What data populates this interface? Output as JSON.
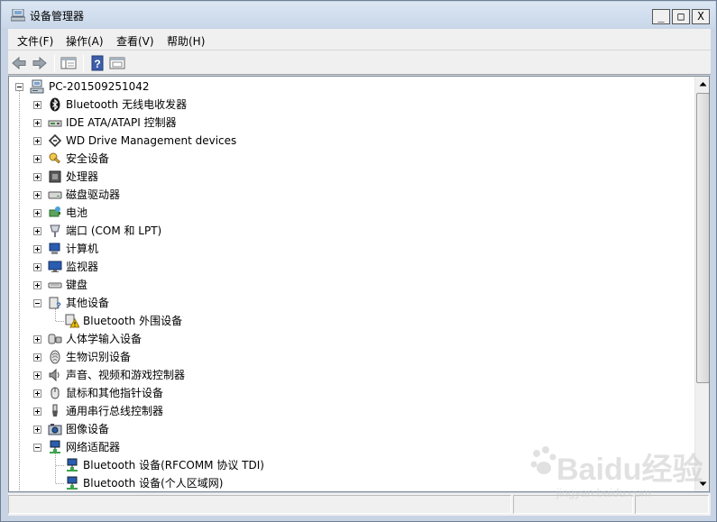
{
  "window": {
    "title": "设备管理器",
    "minimize": "_",
    "maximize": "□",
    "close": "X"
  },
  "menubar": [
    "文件(F)",
    "操作(A)",
    "查看(V)",
    "帮助(H)"
  ],
  "toolbar": {
    "buttons": [
      {
        "name": "back-button",
        "icon": "arrow-left-icon"
      },
      {
        "name": "forward-button",
        "icon": "arrow-right-icon"
      },
      {
        "name": "show-hide-console-tree-button",
        "icon": "console-tree-icon"
      },
      {
        "name": "help-button",
        "icon": "help-book-icon"
      },
      {
        "name": "properties-button",
        "icon": "properties-icon"
      }
    ]
  },
  "tree": {
    "root": "PC-201509251042",
    "items": [
      {
        "label": "Bluetooth 无线电收发器",
        "icon": "bluetooth-icon",
        "level": 1,
        "expander": "plus"
      },
      {
        "label": "IDE ATA/ATAPI 控制器",
        "icon": "ide-controller-icon",
        "level": 1,
        "expander": "plus"
      },
      {
        "label": "WD Drive Management devices",
        "icon": "wd-device-icon",
        "level": 1,
        "expander": "plus"
      },
      {
        "label": "安全设备",
        "icon": "security-device-icon",
        "level": 1,
        "expander": "plus"
      },
      {
        "label": "处理器",
        "icon": "processor-icon",
        "level": 1,
        "expander": "plus"
      },
      {
        "label": "磁盘驱动器",
        "icon": "disk-drive-icon",
        "level": 1,
        "expander": "plus"
      },
      {
        "label": "电池",
        "icon": "battery-icon",
        "level": 1,
        "expander": "plus"
      },
      {
        "label": "端口 (COM 和 LPT)",
        "icon": "port-icon",
        "level": 1,
        "expander": "plus"
      },
      {
        "label": "计算机",
        "icon": "computer-icon",
        "level": 1,
        "expander": "plus"
      },
      {
        "label": "监视器",
        "icon": "monitor-icon",
        "level": 1,
        "expander": "plus"
      },
      {
        "label": "键盘",
        "icon": "keyboard-icon",
        "level": 1,
        "expander": "plus"
      },
      {
        "label": "其他设备",
        "icon": "unknown-device-icon",
        "level": 1,
        "expander": "minus"
      },
      {
        "label": "Bluetooth 外围设备",
        "icon": "warning-device-icon",
        "level": 2,
        "expander": "none"
      },
      {
        "label": "人体学输入设备",
        "icon": "hid-icon",
        "level": 1,
        "expander": "plus"
      },
      {
        "label": "生物识别设备",
        "icon": "biometric-icon",
        "level": 1,
        "expander": "plus"
      },
      {
        "label": "声音、视频和游戏控制器",
        "icon": "sound-icon",
        "level": 1,
        "expander": "plus"
      },
      {
        "label": "鼠标和其他指针设备",
        "icon": "mouse-icon",
        "level": 1,
        "expander": "plus"
      },
      {
        "label": "通用串行总线控制器",
        "icon": "usb-icon",
        "level": 1,
        "expander": "plus"
      },
      {
        "label": "图像设备",
        "icon": "imaging-device-icon",
        "level": 1,
        "expander": "plus"
      },
      {
        "label": "网络适配器",
        "icon": "network-adapter-icon",
        "level": 1,
        "expander": "minus"
      },
      {
        "label": "Bluetooth 设备(RFCOMM 协议 TDI)",
        "icon": "network-adapter-icon",
        "level": 2,
        "expander": "none"
      },
      {
        "label": "Bluetooth 设备(个人区域网)",
        "icon": "network-adapter-icon",
        "level": 2,
        "expander": "none"
      }
    ]
  },
  "watermark": {
    "main": "Baidu经验",
    "sub": "jingyan.baidu.com"
  },
  "colors": {
    "title_bar": "#c9d7e9",
    "window_frame": "#c8d4e4",
    "panel": "#ffffff",
    "chrome": "#f0f0f0"
  }
}
